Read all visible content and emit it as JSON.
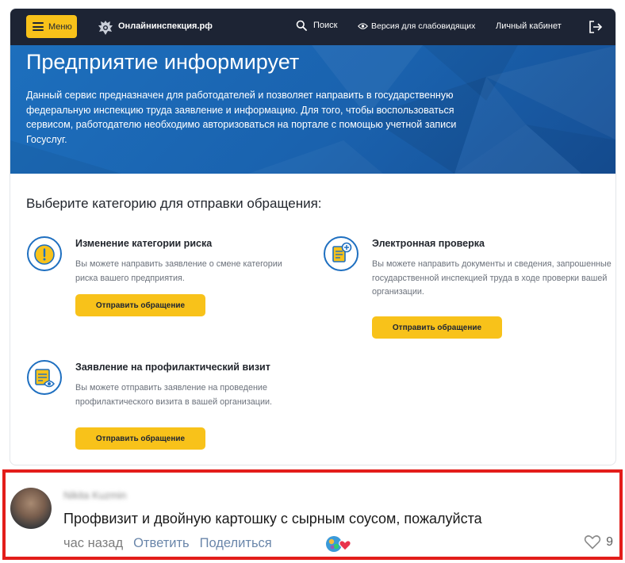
{
  "header": {
    "menu_label": "Меню",
    "site_name": "Онлайнинспекция.рф",
    "search_label": "Поиск",
    "accessibility_label": "Версия для слабовидящих",
    "cabinet_label": "Личный кабинет"
  },
  "hero": {
    "title": "Предприятие информирует",
    "text": "Данный сервис предназначен для работодателей и позволяет направить в государственную федеральную инспекцию труда заявление и информацию. Для того, чтобы воспользоваться сервисом, работодателю необходимо авторизоваться на портале с помощью учетной записи Госуслуг."
  },
  "section_title": "Выберите категорию для отправки обращения:",
  "categories": [
    {
      "title": "Изменение категории риска",
      "description": "Вы можете направить заявление о смене категории риска вашего предприятия.",
      "button": "Отправить обращение",
      "icon": "warning-icon"
    },
    {
      "title": "Электронная проверка",
      "description": "Вы можете направить документы и сведения, запрошенные государственной инспекцией труда в ходе проверки вашей организации.",
      "button": "Отправить обращение",
      "icon": "document-add-icon"
    },
    {
      "title": "Заявление на профилактический визит",
      "description": "Вы можете отправить заявление на проведение профилактического визита в вашей организации.",
      "button": "Отправить обращение",
      "icon": "document-view-icon"
    }
  ],
  "comment": {
    "author": "Nikita Kuzmin",
    "text": "Профвизит и двойную картошку с сырным соусом, пожалуйста",
    "time": "час назад",
    "reply_label": "Ответить",
    "share_label": "Поделиться",
    "likes": "9"
  },
  "colors": {
    "header_bg": "#1d2434",
    "accent_yellow": "#f8c21a",
    "hero_blue": "#1a62ae",
    "icon_blue": "#1e6fc0",
    "highlight_red": "#e31d1a",
    "link_blue": "#6a86aa"
  }
}
